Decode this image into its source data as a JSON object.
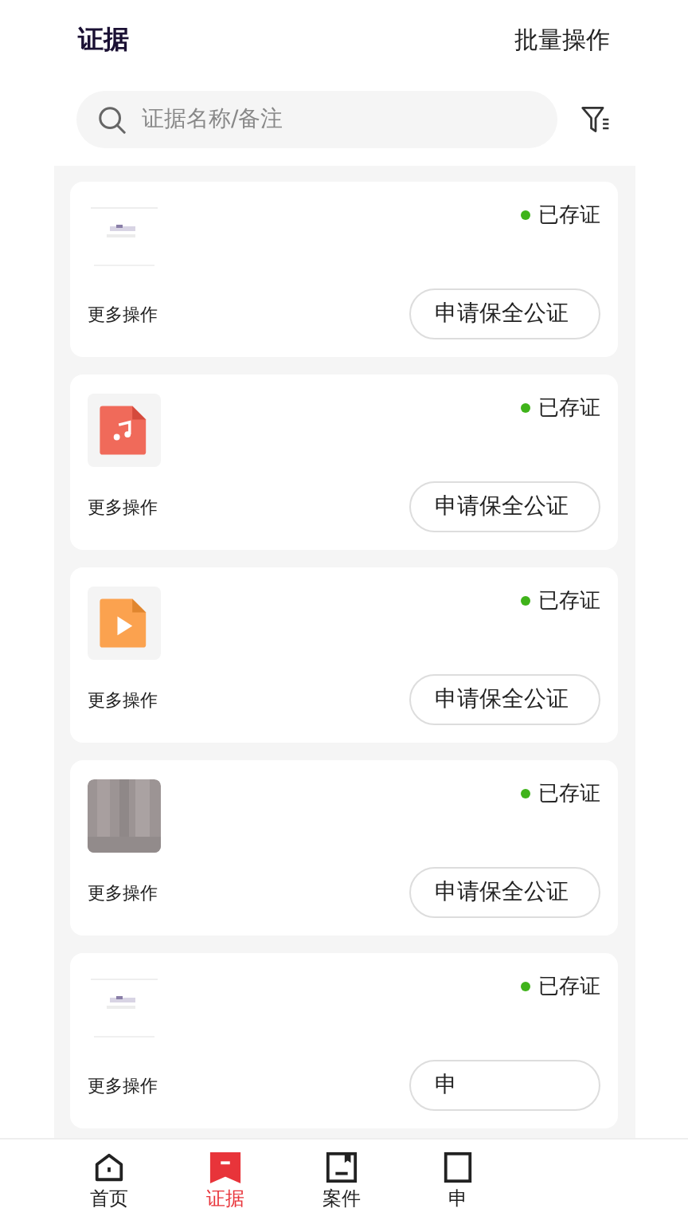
{
  "header": {
    "title": "证据",
    "action": "批量操作"
  },
  "search": {
    "placeholder": "证据名称/备注"
  },
  "cards": [
    {
      "status": "已存证",
      "more": "更多操作",
      "button": "申请保全公证"
    },
    {
      "thumb": {
        "kind": "audio"
      },
      "status": "已存证",
      "more": "更多操作",
      "button": "申请保全公证"
    },
    {
      "thumb": {
        "kind": "video"
      },
      "status": "已存证",
      "more": "更多操作",
      "button": "申请保全公证"
    },
    {
      "status": "已存证",
      "more": "更多操作",
      "button": "申请保全公证"
    },
    {
      "status": "已存证",
      "more": "更多操作",
      "button": "申"
    }
  ],
  "tabs": [
    {
      "label": "首页",
      "selected": false
    },
    {
      "label": "证据",
      "selected": true
    },
    {
      "label": "案件",
      "selected": false
    },
    {
      "label": "申",
      "selected": false
    }
  ]
}
